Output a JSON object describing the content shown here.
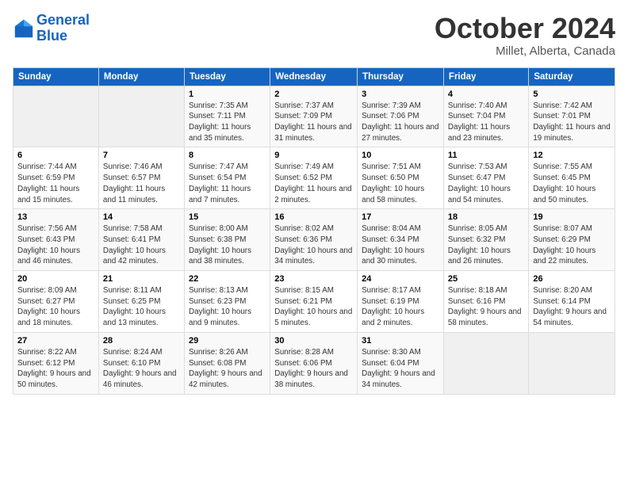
{
  "header": {
    "logo_line1": "General",
    "logo_line2": "Blue",
    "month": "October 2024",
    "location": "Millet, Alberta, Canada"
  },
  "days_of_week": [
    "Sunday",
    "Monday",
    "Tuesday",
    "Wednesday",
    "Thursday",
    "Friday",
    "Saturday"
  ],
  "weeks": [
    [
      {
        "day": "",
        "info": ""
      },
      {
        "day": "",
        "info": ""
      },
      {
        "day": "1",
        "info": "Sunrise: 7:35 AM\nSunset: 7:11 PM\nDaylight: 11 hours and 35 minutes."
      },
      {
        "day": "2",
        "info": "Sunrise: 7:37 AM\nSunset: 7:09 PM\nDaylight: 11 hours and 31 minutes."
      },
      {
        "day": "3",
        "info": "Sunrise: 7:39 AM\nSunset: 7:06 PM\nDaylight: 11 hours and 27 minutes."
      },
      {
        "day": "4",
        "info": "Sunrise: 7:40 AM\nSunset: 7:04 PM\nDaylight: 11 hours and 23 minutes."
      },
      {
        "day": "5",
        "info": "Sunrise: 7:42 AM\nSunset: 7:01 PM\nDaylight: 11 hours and 19 minutes."
      }
    ],
    [
      {
        "day": "6",
        "info": "Sunrise: 7:44 AM\nSunset: 6:59 PM\nDaylight: 11 hours and 15 minutes."
      },
      {
        "day": "7",
        "info": "Sunrise: 7:46 AM\nSunset: 6:57 PM\nDaylight: 11 hours and 11 minutes."
      },
      {
        "day": "8",
        "info": "Sunrise: 7:47 AM\nSunset: 6:54 PM\nDaylight: 11 hours and 7 minutes."
      },
      {
        "day": "9",
        "info": "Sunrise: 7:49 AM\nSunset: 6:52 PM\nDaylight: 11 hours and 2 minutes."
      },
      {
        "day": "10",
        "info": "Sunrise: 7:51 AM\nSunset: 6:50 PM\nDaylight: 10 hours and 58 minutes."
      },
      {
        "day": "11",
        "info": "Sunrise: 7:53 AM\nSunset: 6:47 PM\nDaylight: 10 hours and 54 minutes."
      },
      {
        "day": "12",
        "info": "Sunrise: 7:55 AM\nSunset: 6:45 PM\nDaylight: 10 hours and 50 minutes."
      }
    ],
    [
      {
        "day": "13",
        "info": "Sunrise: 7:56 AM\nSunset: 6:43 PM\nDaylight: 10 hours and 46 minutes."
      },
      {
        "day": "14",
        "info": "Sunrise: 7:58 AM\nSunset: 6:41 PM\nDaylight: 10 hours and 42 minutes."
      },
      {
        "day": "15",
        "info": "Sunrise: 8:00 AM\nSunset: 6:38 PM\nDaylight: 10 hours and 38 minutes."
      },
      {
        "day": "16",
        "info": "Sunrise: 8:02 AM\nSunset: 6:36 PM\nDaylight: 10 hours and 34 minutes."
      },
      {
        "day": "17",
        "info": "Sunrise: 8:04 AM\nSunset: 6:34 PM\nDaylight: 10 hours and 30 minutes."
      },
      {
        "day": "18",
        "info": "Sunrise: 8:05 AM\nSunset: 6:32 PM\nDaylight: 10 hours and 26 minutes."
      },
      {
        "day": "19",
        "info": "Sunrise: 8:07 AM\nSunset: 6:29 PM\nDaylight: 10 hours and 22 minutes."
      }
    ],
    [
      {
        "day": "20",
        "info": "Sunrise: 8:09 AM\nSunset: 6:27 PM\nDaylight: 10 hours and 18 minutes."
      },
      {
        "day": "21",
        "info": "Sunrise: 8:11 AM\nSunset: 6:25 PM\nDaylight: 10 hours and 13 minutes."
      },
      {
        "day": "22",
        "info": "Sunrise: 8:13 AM\nSunset: 6:23 PM\nDaylight: 10 hours and 9 minutes."
      },
      {
        "day": "23",
        "info": "Sunrise: 8:15 AM\nSunset: 6:21 PM\nDaylight: 10 hours and 5 minutes."
      },
      {
        "day": "24",
        "info": "Sunrise: 8:17 AM\nSunset: 6:19 PM\nDaylight: 10 hours and 2 minutes."
      },
      {
        "day": "25",
        "info": "Sunrise: 8:18 AM\nSunset: 6:16 PM\nDaylight: 9 hours and 58 minutes."
      },
      {
        "day": "26",
        "info": "Sunrise: 8:20 AM\nSunset: 6:14 PM\nDaylight: 9 hours and 54 minutes."
      }
    ],
    [
      {
        "day": "27",
        "info": "Sunrise: 8:22 AM\nSunset: 6:12 PM\nDaylight: 9 hours and 50 minutes."
      },
      {
        "day": "28",
        "info": "Sunrise: 8:24 AM\nSunset: 6:10 PM\nDaylight: 9 hours and 46 minutes."
      },
      {
        "day": "29",
        "info": "Sunrise: 8:26 AM\nSunset: 6:08 PM\nDaylight: 9 hours and 42 minutes."
      },
      {
        "day": "30",
        "info": "Sunrise: 8:28 AM\nSunset: 6:06 PM\nDaylight: 9 hours and 38 minutes."
      },
      {
        "day": "31",
        "info": "Sunrise: 8:30 AM\nSunset: 6:04 PM\nDaylight: 9 hours and 34 minutes."
      },
      {
        "day": "",
        "info": ""
      },
      {
        "day": "",
        "info": ""
      }
    ]
  ]
}
